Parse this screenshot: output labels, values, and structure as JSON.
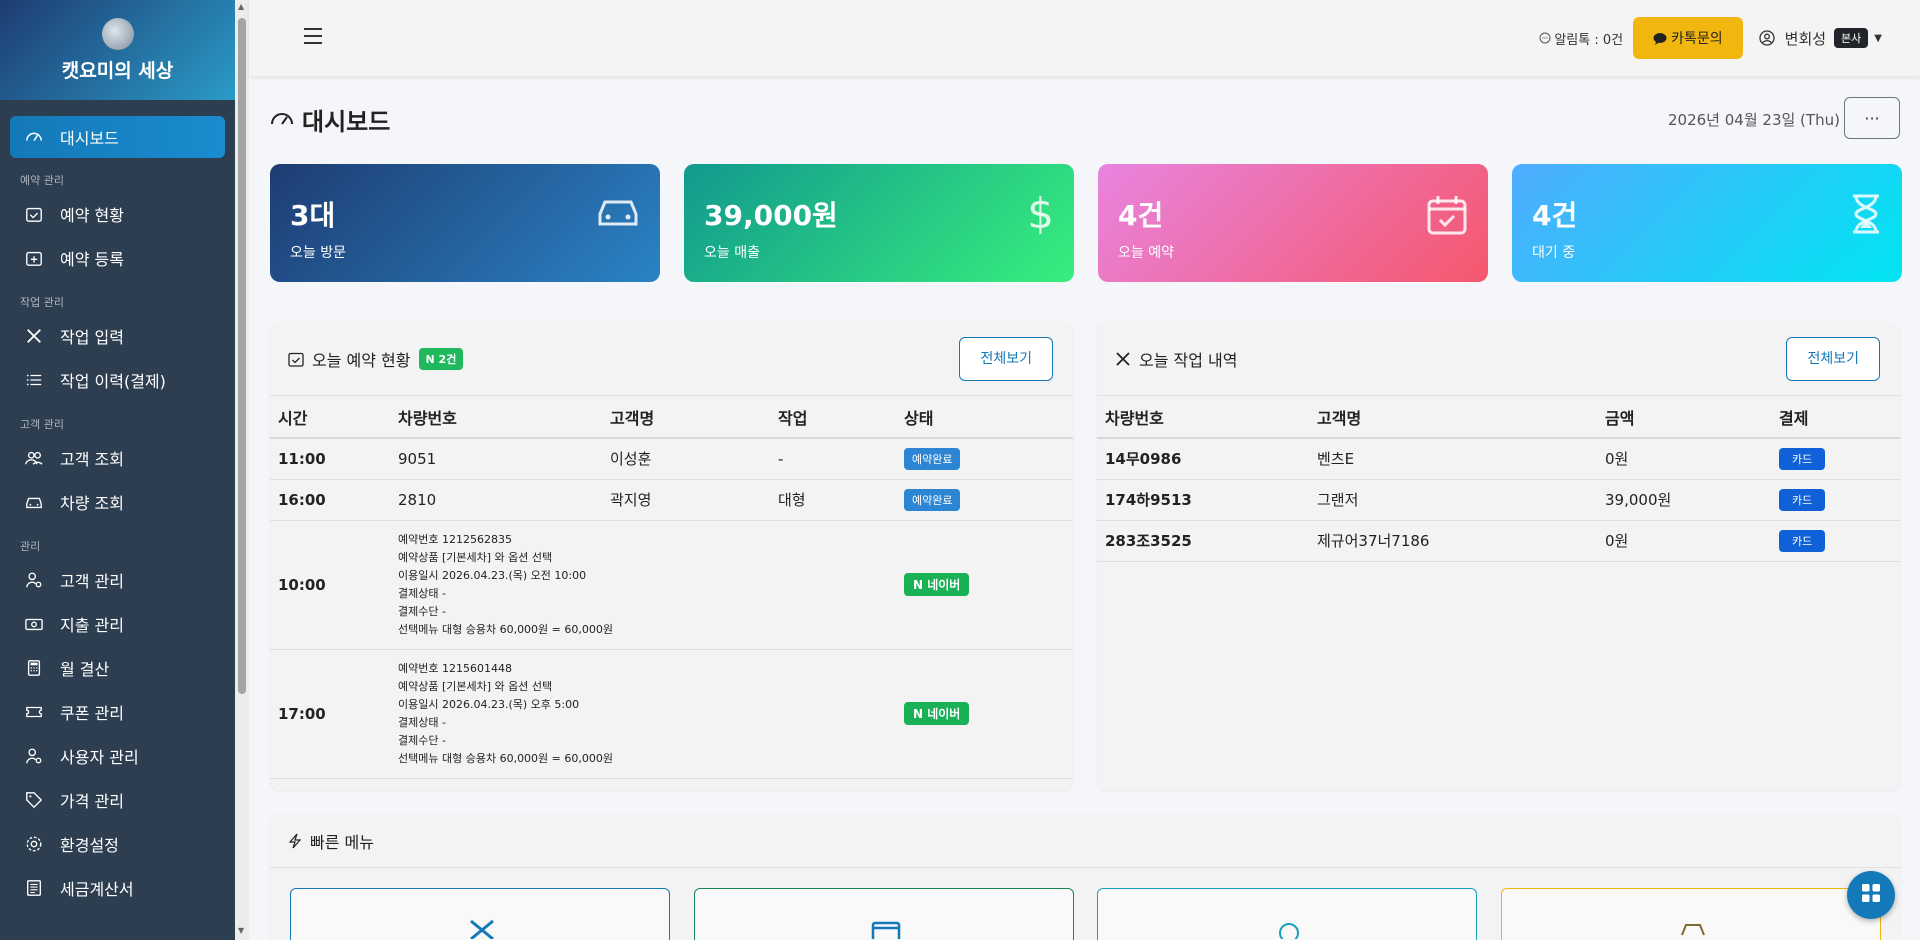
{
  "brand": {
    "name": "캣요미의 세상"
  },
  "sidebar": {
    "dashboard": "대시보드",
    "sections": {
      "reservation": "예약 관리",
      "work": "작업 관리",
      "customer": "고객 관리",
      "admin": "관리"
    },
    "items": {
      "reservation_status": "예약 현황",
      "reservation_register": "예약 등록",
      "work_input": "작업 입력",
      "work_history": "작업 이력(결제)",
      "customer_lookup": "고객 조회",
      "vehicle_lookup": "차량 조회",
      "customer_manage": "고객 관리",
      "expense_manage": "지출 관리",
      "monthly_settle": "월 결산",
      "coupon_manage": "쿠폰 관리",
      "user_manage": "사용자 관리",
      "price_manage": "가격 관리",
      "settings": "환경설정",
      "tax_invoice": "세금계산서"
    }
  },
  "header": {
    "alimtalk": "알림톡 : 0건",
    "kakao": "카톡문의",
    "user_name": "변회성",
    "user_badge": "본사"
  },
  "page": {
    "title": "대시보드",
    "date": "2026년 04월 23일 (Thu)",
    "more": "···"
  },
  "stats": [
    {
      "value": "3대",
      "label": "오늘 방문",
      "icon": "car-icon",
      "color": "#1e3c72"
    },
    {
      "value": "39,000원",
      "label": "오늘 매출",
      "icon": "dollar-icon",
      "color": "#11998e"
    },
    {
      "value": "4건",
      "label": "오늘 예약",
      "icon": "calendar-check-icon",
      "color": "#ee5a7e"
    },
    {
      "value": "4건",
      "label": "대기 중",
      "icon": "hourglass-icon",
      "color": "#1fc8f0"
    }
  ],
  "reservations": {
    "title": "오늘 예약 현황",
    "badge": "N 2건",
    "view_all": "전체보기",
    "headers": [
      "시간",
      "차량번호",
      "고객명",
      "작업",
      "상태"
    ],
    "rows": [
      {
        "time": "11:00",
        "plate": "9051",
        "name": "이성훈",
        "work": "-",
        "status": "예약완료"
      },
      {
        "time": "16:00",
        "plate": "2810",
        "name": "곽지영",
        "work": "대형",
        "status": "예약완료"
      }
    ],
    "naver_rows": [
      {
        "time": "10:00",
        "lines": [
          "예약번호 1212562835",
          "예약상품 [기본세차] 와 옵션 선택",
          "이용일시 2026.04.23.(목) 오전 10:00",
          "결제상태 -",
          "결제수단 -",
          "선택메뉴 대형 승용차 60,000원 = 60,000원"
        ],
        "status": "N 네이버"
      },
      {
        "time": "17:00",
        "lines": [
          "예약번호 1215601448",
          "예약상품 [기본세차] 와 옵션 선택",
          "이용일시 2026.04.23.(목) 오후 5:00",
          "결제상태 -",
          "결제수단 -",
          "선택메뉴 대형 승용차 60,000원 = 60,000원"
        ],
        "status": "N 네이버"
      }
    ]
  },
  "work_log": {
    "title": "오늘 작업 내역",
    "view_all": "전체보기",
    "headers": [
      "차량번호",
      "고객명",
      "금액",
      "결제"
    ],
    "rows": [
      {
        "plate": "14무0986",
        "name": "벤츠E",
        "amount": "0원",
        "pay": "카드"
      },
      {
        "plate": "174하9513",
        "name": "그랜저",
        "amount": "39,000원",
        "pay": "카드"
      },
      {
        "plate": "283조3525",
        "name": "제규어37너7186",
        "amount": "0원",
        "pay": "카드"
      }
    ]
  },
  "quick_menu": {
    "title": "빠른 메뉴"
  }
}
